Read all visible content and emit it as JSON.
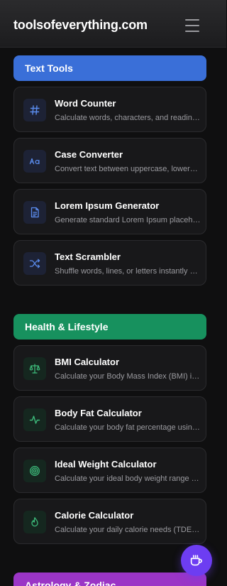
{
  "header": {
    "brand": "toolsofeverything.com",
    "menu_icon": "hamburger-icon"
  },
  "sections": [
    {
      "title": "Text Tools",
      "color": "#3a6fd8",
      "tools": [
        {
          "name": "Word Counter",
          "desc": "Calculate words, characters, and reading time",
          "icon": "hash-icon"
        },
        {
          "name": "Case Converter",
          "desc": "Convert text between uppercase, lowercase, and more",
          "icon": "text-case-icon"
        },
        {
          "name": "Lorem Ipsum Generator",
          "desc": "Generate standard Lorem Ipsum placeholder text",
          "icon": "document-icon"
        },
        {
          "name": "Text Scrambler",
          "desc": "Shuffle words, lines, or letters instantly online",
          "icon": "shuffle-icon"
        }
      ]
    },
    {
      "title": "Health & Lifestyle",
      "color": "#17915e",
      "tools": [
        {
          "name": "BMI Calculator",
          "desc": "Calculate your Body Mass Index (BMI) instantly",
          "icon": "scale-icon"
        },
        {
          "name": "Body Fat Calculator",
          "desc": "Calculate your body fat percentage using measurements",
          "icon": "activity-icon"
        },
        {
          "name": "Ideal Weight Calculator",
          "desc": "Calculate your ideal body weight range instantly",
          "icon": "target-icon"
        },
        {
          "name": "Calorie Calculator",
          "desc": "Calculate your daily calorie needs (TDEE) instantly",
          "icon": "flame-icon"
        }
      ]
    },
    {
      "title": "Astrology & Zodiac",
      "color": "#9b35c6",
      "tools": []
    }
  ],
  "fab": {
    "icon": "coffee-cup-icon"
  }
}
